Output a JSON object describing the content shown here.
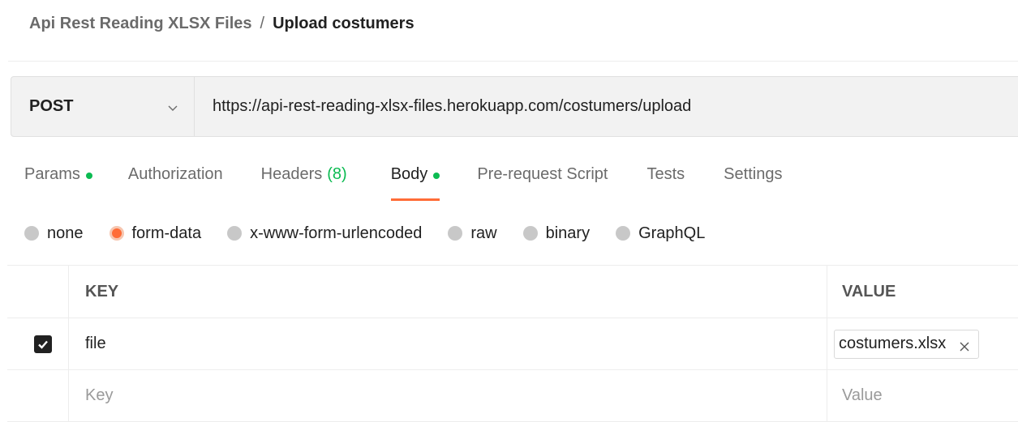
{
  "breadcrumb": {
    "parent": "Api Rest Reading XLSX Files",
    "separator": "/",
    "current": "Upload costumers"
  },
  "request": {
    "method": "POST",
    "url": "https://api-rest-reading-xlsx-files.herokuapp.com/costumers/upload"
  },
  "tabs": [
    {
      "label": "Params",
      "indicator": "dot",
      "active": false
    },
    {
      "label": "Authorization",
      "active": false
    },
    {
      "label": "Headers",
      "count": "(8)",
      "active": false
    },
    {
      "label": "Body",
      "indicator": "dot",
      "active": true
    },
    {
      "label": "Pre-request Script",
      "active": false
    },
    {
      "label": "Tests",
      "active": false
    },
    {
      "label": "Settings",
      "active": false
    }
  ],
  "body_types": [
    {
      "label": "none",
      "selected": false
    },
    {
      "label": "form-data",
      "selected": true
    },
    {
      "label": "x-www-form-urlencoded",
      "selected": false
    },
    {
      "label": "raw",
      "selected": false
    },
    {
      "label": "binary",
      "selected": false
    },
    {
      "label": "GraphQL",
      "selected": false
    }
  ],
  "table": {
    "headers": {
      "key": "KEY",
      "value": "VALUE"
    },
    "rows": [
      {
        "checked": true,
        "key": "file",
        "value": "costumers.xlsx"
      }
    ],
    "placeholders": {
      "key": "Key",
      "value": "Value"
    }
  },
  "colors": {
    "accent": "#ff6c37",
    "indicator": "#0cbb52"
  },
  "icons": {
    "method_dropdown": "chevron-down-icon",
    "checkbox": "check-icon",
    "remove_file": "close-icon"
  }
}
